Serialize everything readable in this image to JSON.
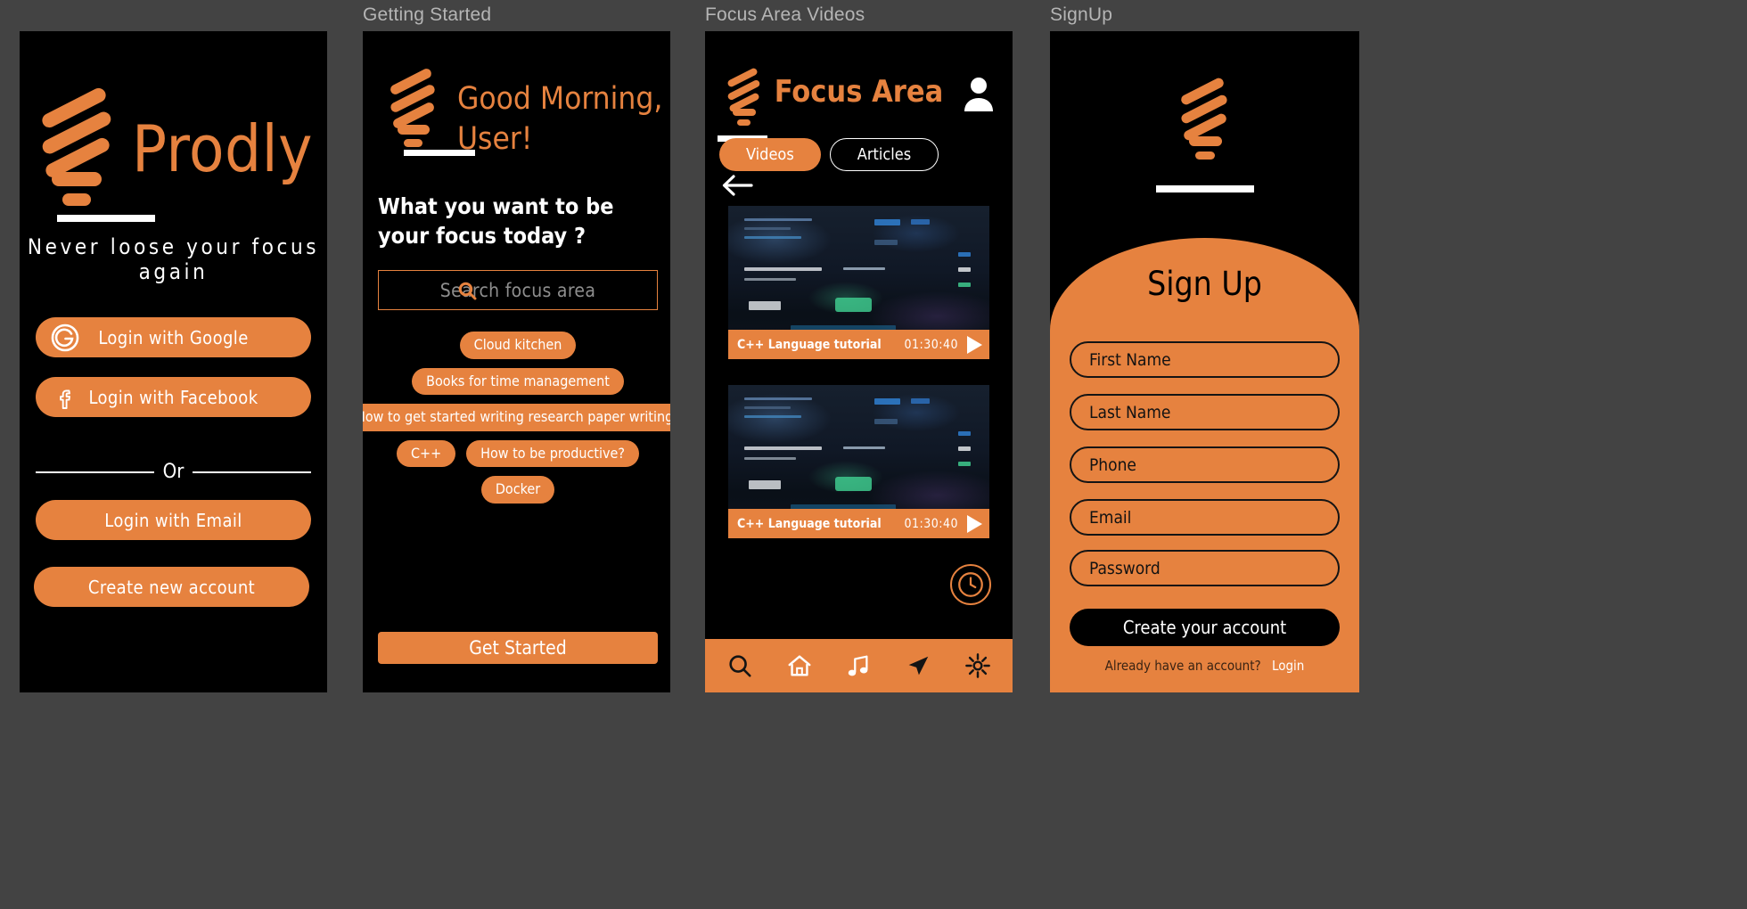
{
  "colors": {
    "accent": "#e6823f",
    "dark": "#000000",
    "canvas": "#434343",
    "label": "#b5b5b5"
  },
  "frames": [
    {
      "label": ""
    },
    {
      "label": "Getting Started"
    },
    {
      "label": "Focus Area Videos"
    },
    {
      "label": "SignUp"
    }
  ],
  "login_screen": {
    "brand_name": "Prodly",
    "tagline": "Never loose your focus again",
    "google_label": "Login with Google",
    "facebook_label": "Login with Facebook",
    "or_label": "Or",
    "email_label": "Login with Email",
    "create_label": "Create new account"
  },
  "getting_started": {
    "greeting_line1": "Good Morning,",
    "greeting_line2": "User!",
    "question": "What you want to be your focus today ?",
    "search_placeholder": "Search focus area",
    "search_icon": "search-icon",
    "tags": [
      "Cloud kitchen",
      "Books for time management",
      "How to get started writing research paper writing?",
      "C++",
      "How to be productive?",
      "Docker"
    ],
    "cta_label": "Get Started"
  },
  "focus_area": {
    "title": "Focus Area",
    "avatar_icon": "user-icon",
    "back_icon": "back-arrow-icon",
    "tabs": [
      {
        "label": "Videos",
        "active": true
      },
      {
        "label": "Articles",
        "active": false
      }
    ],
    "videos": [
      {
        "title": "C++ Language tutorial",
        "duration": "01:30:40",
        "play_icon": "play-icon"
      },
      {
        "title": "C++ Language tutorial",
        "duration": "01:30:40",
        "play_icon": "play-icon"
      }
    ],
    "fab_icon": "clock-icon",
    "nav_items": [
      {
        "icon": "search-icon",
        "active": true
      },
      {
        "icon": "home-icon",
        "active": false
      },
      {
        "icon": "music-icon",
        "active": false
      },
      {
        "icon": "navigation-icon",
        "active": false
      },
      {
        "icon": "gear-icon",
        "active": false
      }
    ]
  },
  "signup": {
    "title": "Sign Up",
    "fields": [
      {
        "placeholder": "First Name",
        "value": "First Name"
      },
      {
        "placeholder": "Last Name",
        "value": "Last Name"
      },
      {
        "placeholder": "Phone",
        "value": "Phone"
      },
      {
        "placeholder": "Email",
        "value": "Email"
      },
      {
        "placeholder": "Password",
        "value": "Password"
      }
    ],
    "submit_label": "Create your account",
    "already_text": "Already have an account?",
    "login_link": "Login"
  }
}
